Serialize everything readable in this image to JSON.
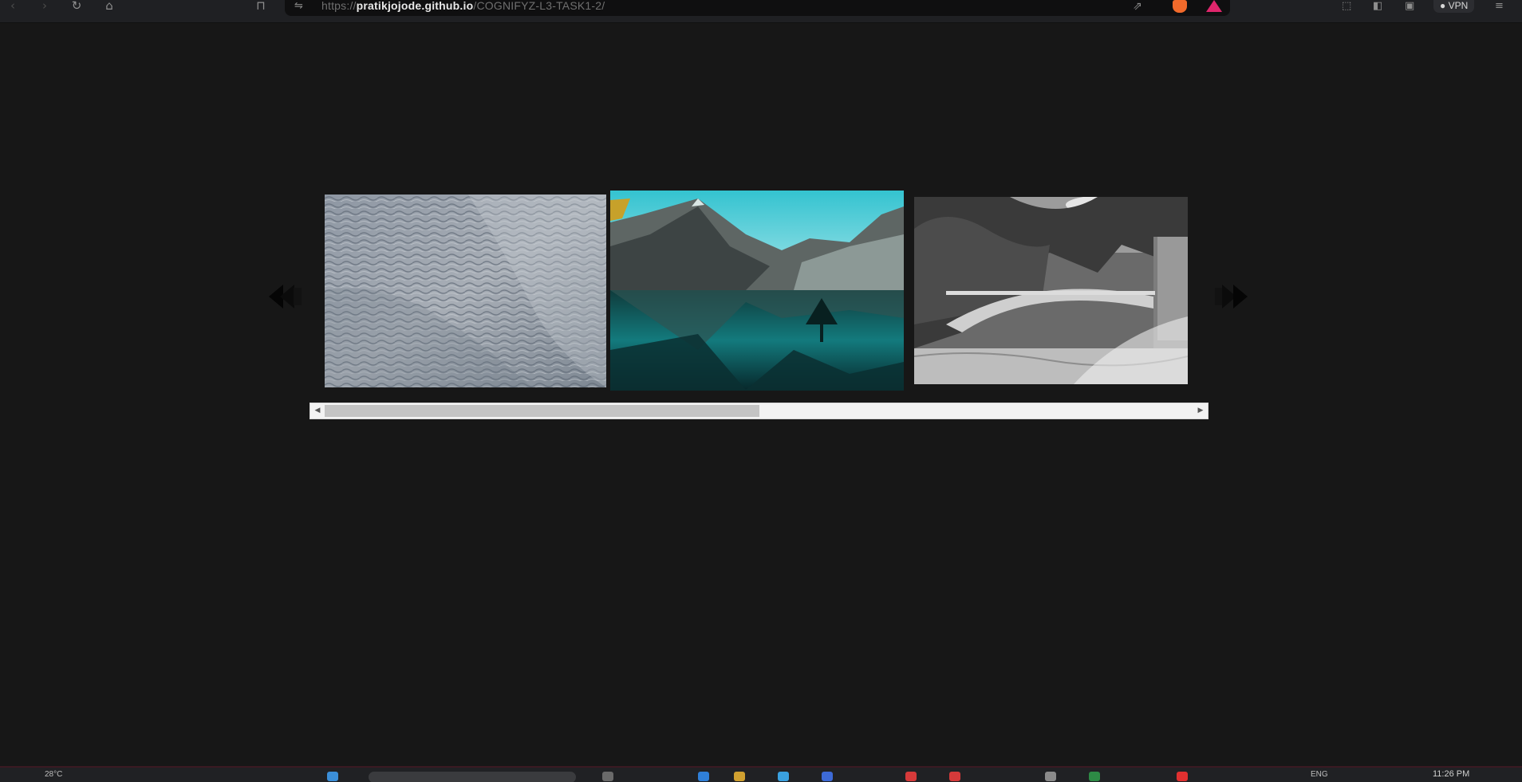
{
  "browser": {
    "url_prefix": "https://",
    "url_host": "pratikjojode.github.io",
    "url_path": "/COGNIFYZ-L3-TASK1-2/",
    "vpn_label": "VPN",
    "icons": {
      "back": "back-arrow-icon",
      "forward": "forward-arrow-icon",
      "reload": "reload-icon",
      "home": "home-icon",
      "bookmark": "bookmark-icon",
      "site_info": "site-info-icon",
      "share": "share-icon",
      "brave": "brave-shield-icon",
      "rewards": "brave-rewards-icon",
      "extensions": "extensions-icon",
      "sidebar": "sidebar-icon",
      "wallet": "wallet-icon",
      "menu": "menu-icon"
    }
  },
  "carousel": {
    "slides": [
      {
        "name": "water-ripples",
        "style": "desaturated blue-grey water surface"
      },
      {
        "name": "mountain-lake",
        "style": "teal sky, rocky mountains, reflection"
      },
      {
        "name": "stone-bridge",
        "style": "black and white bridge with trees"
      }
    ],
    "prev_icon": "double-left-arrow-icon",
    "next_icon": "double-right-arrow-icon",
    "scroll_position": 0.5
  },
  "taskbar": {
    "language": "ENG",
    "weather": "28°C",
    "clock": "11:26 PM"
  },
  "colors": {
    "page_bg": "#171717",
    "scrollbar_track": "#f2f2f2",
    "scrollbar_thumb": "#c4c4c4"
  }
}
